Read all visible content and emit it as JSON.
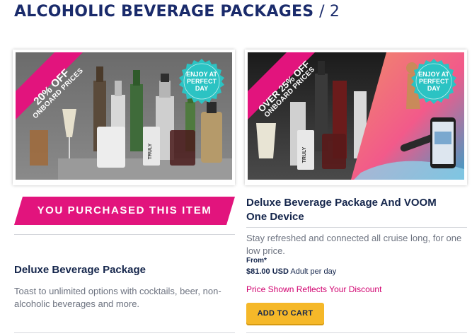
{
  "page": {
    "title": "ALCOHOLIC BEVERAGE PACKAGES",
    "count": "/ 2"
  },
  "colors": {
    "brand_navy": "#1a2b6b",
    "ribbon_pink": "#e2147d",
    "seal_teal": "#2bc3c3",
    "cart_yellow": "#f5b829"
  },
  "cards": [
    {
      "ribbon": {
        "big": "20% OFF",
        "small": "ONBOARD PRICES"
      },
      "seal": {
        "line1": "ENJOY AT",
        "line2": "PERFECT",
        "line3": "DAY"
      },
      "purchased_label": "YOU PURCHASED THIS ITEM",
      "title": "Deluxe Beverage Package",
      "description": "Toast to unlimited options with cocktails, beer, non-alcoholic beverages and more."
    },
    {
      "ribbon": {
        "big": "OVER 25% OFF",
        "small": "ONBOARD PRICES"
      },
      "seal": {
        "line1": "ENJOY AT",
        "line2": "PERFECT",
        "line3": "DAY"
      },
      "title": "Deluxe Beverage Package And VOOM One Device",
      "description": "Stay refreshed and connected all cruise long, for one low price.",
      "price_from": "From*",
      "price": "$81.00",
      "currency": "USD",
      "price_unit": "Adult per day",
      "discount_note": "Price Shown Reflects Your Discount",
      "add_to_cart": "ADD TO CART"
    }
  ]
}
